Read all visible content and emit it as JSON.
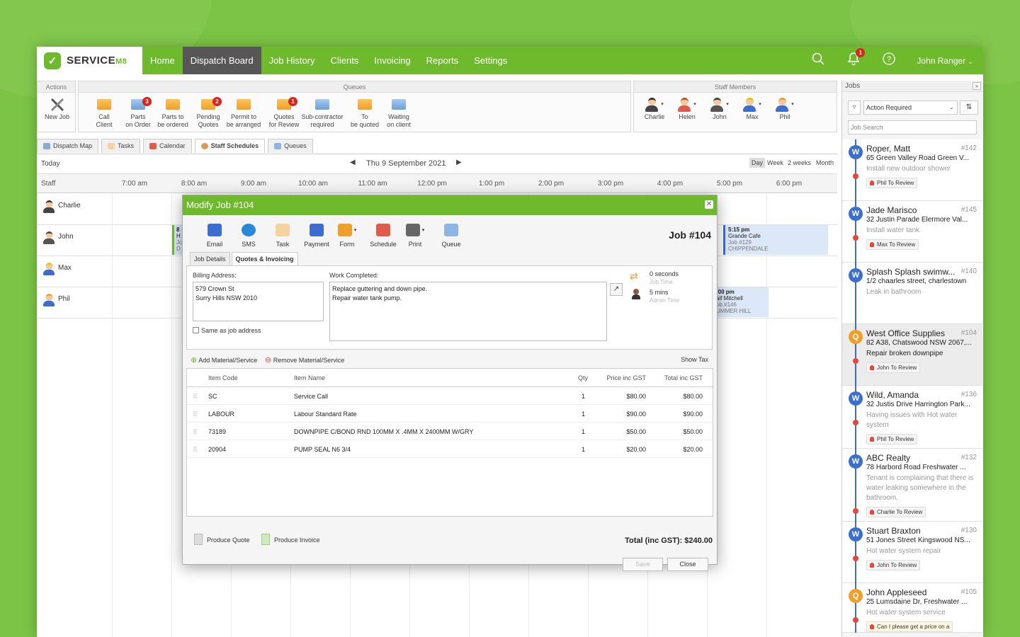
{
  "nav": {
    "logo_text": "SERVICE",
    "logo_suffix": "M8",
    "items": [
      "Home",
      "Dispatch Board",
      "Job History",
      "Clients",
      "Invoicing",
      "Reports",
      "Settings"
    ],
    "notification_count": "1",
    "user": "John Ranger"
  },
  "ribbon": {
    "actions_title": "Actions",
    "new_job": "New Job",
    "queues_title": "Queues",
    "queues": [
      {
        "l1": "Call",
        "l2": "Client",
        "badge": "",
        "color": "orange"
      },
      {
        "l1": "Parts",
        "l2": "on Order",
        "badge": "3",
        "color": "blue"
      },
      {
        "l1": "Parts to",
        "l2": "be ordered",
        "badge": "",
        "color": "orange"
      },
      {
        "l1": "Pending",
        "l2": "Quotes",
        "badge": "2",
        "color": "orange"
      },
      {
        "l1": "Permit to",
        "l2": "be arranged",
        "badge": "",
        "color": "orange"
      },
      {
        "l1": "Quotes",
        "l2": "for Review",
        "badge": "1",
        "color": "orange"
      },
      {
        "l1": "Sub-contractor",
        "l2": "required",
        "badge": "",
        "color": "blue"
      },
      {
        "l1": "To",
        "l2": "be quoted",
        "badge": "",
        "color": "orange"
      },
      {
        "l1": "Waiting",
        "l2": "on client",
        "badge": "",
        "color": "blue"
      }
    ],
    "staff_title": "Staff Members",
    "staff": [
      "Charlie",
      "Helen",
      "John",
      "Max",
      "Phil"
    ]
  },
  "tabs": [
    "Dispatch Map",
    "Tasks",
    "Calendar",
    "Staff Schedules",
    "Queues"
  ],
  "schedule": {
    "today": "Today",
    "date": "Thu 9 September 2021",
    "views": [
      "Day",
      "Week",
      "2 weeks",
      "Month"
    ],
    "staff_label": "Staff",
    "times": [
      "7:00 am",
      "8:00 am",
      "9:00 am",
      "10:00 am",
      "11:00 am",
      "12:00 pm",
      "1:00 pm",
      "2:00 pm",
      "3:00 pm",
      "4:00 pm",
      "5:00 pm",
      "6:00 pm"
    ],
    "rows": [
      "Charlie",
      "John",
      "Max",
      "Phil"
    ],
    "event1": {
      "time": "5:15 pm",
      "name": "Grande Cafe",
      "job": "Job #129",
      "area": "CHIPPENDALE"
    },
    "event2": {
      "time": ":00 pm",
      "name": "aif Mitchell",
      "job": "ob #146",
      "area": "UMMER HILL"
    },
    "event3": {
      "l1": "8",
      "l2": "H",
      "l3": "Jc",
      "l4": "D"
    }
  },
  "modal": {
    "title": "Modify Job #104",
    "tools": [
      "Email",
      "SMS",
      "Task",
      "Payment",
      "Form",
      "Schedule",
      "Print",
      "Queue"
    ],
    "job_no": "Job #104",
    "tabs": [
      "Job Details",
      "Quotes & Invoicing"
    ],
    "billing_label": "Billing Address:",
    "billing_l1": "579 Crown St",
    "billing_l2": "Surry Hills NSW 2010",
    "same_addr": "Same as job address",
    "work_label": "Work Completed:",
    "work_l1": "Replace guttering and down pipe.",
    "work_l2": "Repair water tank pump.",
    "job_time": "0 seconds",
    "job_time_label": "Job Time",
    "admin_time": "5 mins",
    "admin_time_label": "Admin Time",
    "add_material": "Add Material/Service",
    "remove_material": "Remove Material/Service",
    "show_tax": "Show Tax",
    "columns": [
      "Item Code",
      "Item Name",
      "Qty",
      "Price inc GST",
      "Total inc GST"
    ],
    "items": [
      {
        "code": "SC",
        "name": "Service Call",
        "qty": "1",
        "price": "$80.00",
        "total": "$80.00"
      },
      {
        "code": "LABOUR",
        "name": "Labour Standard Rate",
        "qty": "1",
        "price": "$90.00",
        "total": "$90.00"
      },
      {
        "code": "73189",
        "name": "DOWNPIPE C/BOND RND 100MM X .4MM X 2400MM W/GRY",
        "qty": "1",
        "price": "$50.00",
        "total": "$50.00"
      },
      {
        "code": "20904",
        "name": "PUMP SEAL N6 3/4",
        "qty": "1",
        "price": "$20.00",
        "total": "$20.00"
      }
    ],
    "produce_quote": "Produce Quote",
    "produce_invoice": "Produce Invoice",
    "total": "Total (inc GST): $240.00",
    "save": "Save",
    "close": "Close"
  },
  "jobs": {
    "title": "Jobs",
    "filter": "Action Required",
    "search_placeholder": "Job Search",
    "cards": [
      {
        "letter": "W",
        "color": "#3b6ecf",
        "name": "Roper, Matt",
        "num": "#142",
        "addr": "65 Green Valley Road Green V...",
        "desc": "Install new outdoor shower",
        "tag": "Phil To Review"
      },
      {
        "letter": "W",
        "color": "#3b6ecf",
        "name": "Jade Marisco",
        "num": "#145",
        "addr": "32 Justin Parade Elermore Val...",
        "desc": "Install water tank",
        "tag": "Max To Review"
      },
      {
        "letter": "W",
        "color": "#3b6ecf",
        "name": "Splash Splash swimw...",
        "num": "#140",
        "addr": "1/2 chaarles street, charlestown",
        "desc": "Leak in bathroom",
        "tag": ""
      },
      {
        "letter": "Q",
        "color": "#f0a02a",
        "name": "West Office Supplies",
        "num": "#104",
        "addr": "82 A38, Chatswood NSW 2067,...",
        "desc": "Repair broken downpipe",
        "tag": "John To Review"
      },
      {
        "letter": "W",
        "color": "#3b6ecf",
        "name": "Wild, Amanda",
        "num": "#136",
        "addr": "32 Justis Drive Harrington Park...",
        "desc": "Having issues with Hot water system",
        "tag": "Phil To Review"
      },
      {
        "letter": "W",
        "color": "#3b6ecf",
        "name": "ABC Realty",
        "num": "#132",
        "addr": "78 Harbord Road Freshwater ...",
        "desc": "Tenant is complaining that there is water leaking somewhere in the bathroom.",
        "tag": "Charlie To Review"
      },
      {
        "letter": "W",
        "color": "#3b6ecf",
        "name": "Stuart Braxton",
        "num": "#130",
        "addr": "51 Jones Street Kingswood NS...",
        "desc": "Hot water system repair",
        "tag": "John To Review"
      },
      {
        "letter": "Q",
        "color": "#f0a02a",
        "name": "John Appleseed",
        "num": "#105",
        "addr": "25 Lumsdaine Dr, Freshwater ...",
        "desc": "Hot water system service",
        "tag": "Can I please get a price on a"
      }
    ]
  }
}
